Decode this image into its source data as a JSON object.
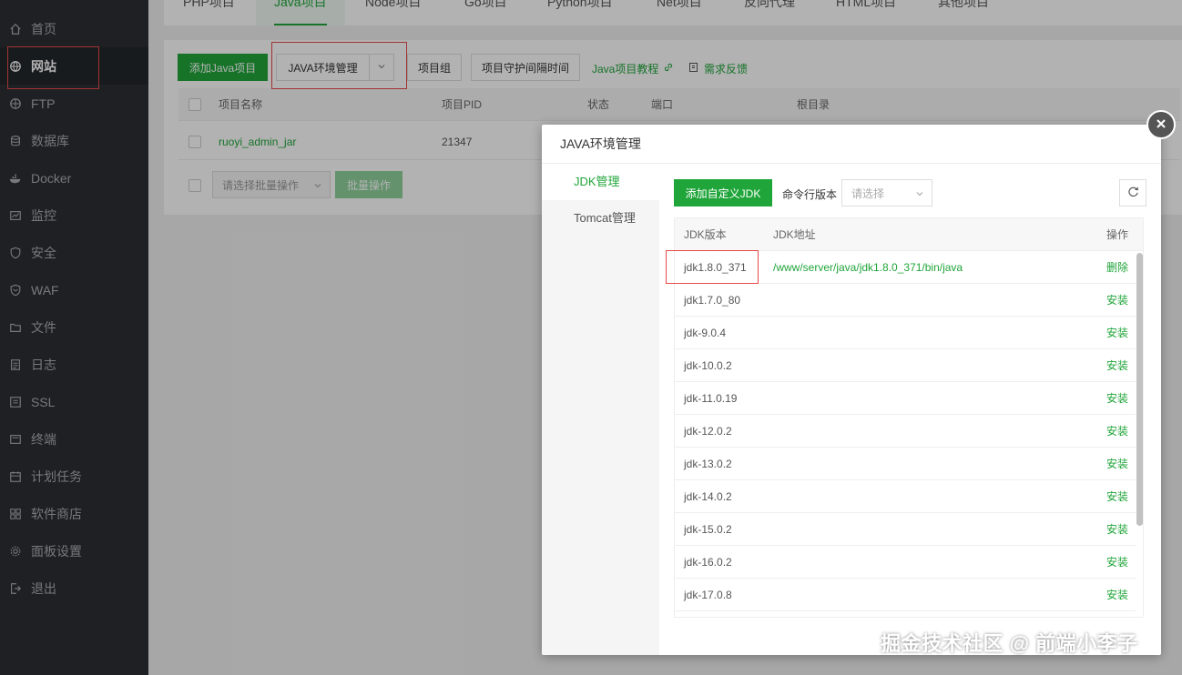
{
  "sidebar": {
    "items": [
      {
        "label": "首页",
        "icon": "home-icon"
      },
      {
        "label": "网站",
        "icon": "globe-icon"
      },
      {
        "label": "FTP",
        "icon": "ftp-icon"
      },
      {
        "label": "数据库",
        "icon": "database-icon"
      },
      {
        "label": "Docker",
        "icon": "docker-icon"
      },
      {
        "label": "监控",
        "icon": "monitor-icon"
      },
      {
        "label": "安全",
        "icon": "shield-icon"
      },
      {
        "label": "WAF",
        "icon": "waf-shield-icon"
      },
      {
        "label": "文件",
        "icon": "folder-icon"
      },
      {
        "label": "日志",
        "icon": "log-icon"
      },
      {
        "label": "SSL",
        "icon": "ssl-icon"
      },
      {
        "label": "终端",
        "icon": "terminal-icon"
      },
      {
        "label": "计划任务",
        "icon": "calendar-icon"
      },
      {
        "label": "软件商店",
        "icon": "grid-icon"
      },
      {
        "label": "面板设置",
        "icon": "gear-icon"
      },
      {
        "label": "退出",
        "icon": "logout-icon"
      }
    ],
    "active_index": 1
  },
  "top_tabs": [
    "PHP项目",
    "Java项目",
    "Node项目",
    "Go项目",
    "Python项目",
    "Net项目",
    "反向代理",
    "HTML项目",
    "其他项目"
  ],
  "toolbar": {
    "add_java": "添加Java项目",
    "java_env": "JAVA环境管理",
    "project_group": "项目组",
    "guard_interval": "项目守护间隔时间",
    "tutorial": "Java项目教程",
    "feedback": "需求反馈"
  },
  "project_table": {
    "headers": [
      "项目名称",
      "项目PID",
      "状态",
      "端口",
      "根目录"
    ],
    "rows": [
      {
        "name": "ruoyi_admin_jar",
        "pid": "21347"
      }
    ]
  },
  "batch": {
    "select_placeholder": "请选择批量操作",
    "button": "批量操作"
  },
  "modal": {
    "title": "JAVA环境管理",
    "side_tabs": [
      "JDK管理",
      "Tomcat管理"
    ],
    "add_jdk": "添加自定义JDK",
    "cmd_version_label": "命令行版本",
    "cmd_version_placeholder": "请选择",
    "table_headers": [
      "JDK版本",
      "JDK地址",
      "操作"
    ],
    "rows": [
      {
        "version": "jdk1.8.0_371",
        "path": "/www/server/java/jdk1.8.0_371/bin/java",
        "action": "删除"
      },
      {
        "version": "jdk1.7.0_80",
        "path": "",
        "action": "安装"
      },
      {
        "version": "jdk-9.0.4",
        "path": "",
        "action": "安装"
      },
      {
        "version": "jdk-10.0.2",
        "path": "",
        "action": "安装"
      },
      {
        "version": "jdk-11.0.19",
        "path": "",
        "action": "安装"
      },
      {
        "version": "jdk-12.0.2",
        "path": "",
        "action": "安装"
      },
      {
        "version": "jdk-13.0.2",
        "path": "",
        "action": "安装"
      },
      {
        "version": "jdk-14.0.2",
        "path": "",
        "action": "安装"
      },
      {
        "version": "jdk-15.0.2",
        "path": "",
        "action": "安装"
      },
      {
        "version": "jdk-16.0.2",
        "path": "",
        "action": "安装"
      },
      {
        "version": "jdk-17.0.8",
        "path": "",
        "action": "安装"
      }
    ]
  },
  "watermark": "掘金技术社区 @ 前端小李子",
  "colors": {
    "accent": "#20a53a",
    "sidebar_bg": "#2b2f33",
    "highlight": "#e64a4a"
  }
}
